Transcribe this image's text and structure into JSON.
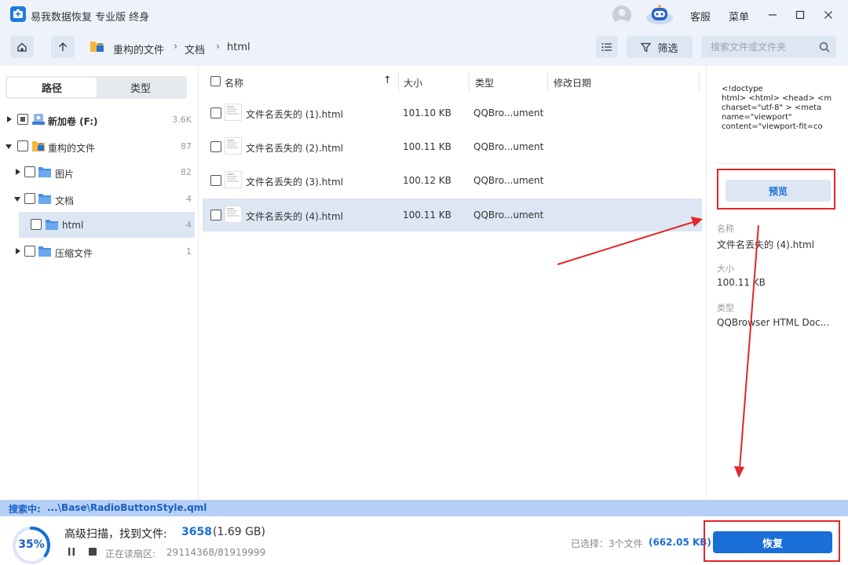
{
  "app": {
    "title": "易我数据恢复 专业版 终身",
    "service_label": "客服",
    "menu_label": "菜单"
  },
  "navbar": {
    "breadcrumb": [
      "重构的文件",
      "文档",
      "html"
    ],
    "filter_label": "筛选",
    "search_placeholder": "搜索文件或文件夹"
  },
  "left_panel": {
    "tabs": [
      {
        "label": "路径",
        "active": true
      },
      {
        "label": "类型",
        "active": false
      }
    ],
    "tree": [
      {
        "label": "新加卷 (F:)",
        "count": "3.6K",
        "icon": "drive-icon",
        "expanded": false,
        "selected": false
      },
      {
        "label": "重构的文件",
        "count": "87",
        "icon": "folder-lock-icon",
        "expanded": true,
        "selected": false
      },
      {
        "label": "图片",
        "count": "82",
        "icon": "folder-icon",
        "expanded": false,
        "selected": false
      },
      {
        "label": "文档",
        "count": "4",
        "icon": "folder-icon",
        "expanded": true,
        "selected": false
      },
      {
        "label": "html",
        "count": "4",
        "icon": "folder-icon",
        "expanded": false,
        "selected": true
      },
      {
        "label": "压缩文件",
        "count": "1",
        "icon": "folder-icon",
        "expanded": false,
        "selected": false
      }
    ]
  },
  "file_list": {
    "columns": [
      "名称",
      "大小",
      "类型",
      "修改日期"
    ],
    "rows": [
      {
        "name": "文件名丢失的 (1).html",
        "size": "101.10 KB",
        "type": "QQBro...ument",
        "date": "",
        "selected": false
      },
      {
        "name": "文件名丢失的 (2).html",
        "size": "100.11 KB",
        "type": "QQBro...ument",
        "date": "",
        "selected": false
      },
      {
        "name": "文件名丢失的 (3).html",
        "size": "100.12 KB",
        "type": "QQBro...ument",
        "date": "",
        "selected": false
      },
      {
        "name": "文件名丢失的 (4).html",
        "size": "100.11 KB",
        "type": "QQBro...ument",
        "date": "",
        "selected": true
      }
    ]
  },
  "right_panel": {
    "code_preview": "<!doctype\nhtml> <html> <head> <m\ncharset=\"utf-8\" > <meta\nname=\"viewport\"\ncontent=\"viewport-fit=co",
    "preview_label": "预览",
    "name_label": "名称",
    "name_value": "文件名丢失的 (4).html",
    "size_label": "大小",
    "size_value": "100.11 KB",
    "type_label": "类型",
    "type_value": "QQBrowser HTML Doc..."
  },
  "status": {
    "scan_label": "搜索中:",
    "scan_path": "...\\Base\\RadioButtonStyle.qml",
    "progress_text": "35%",
    "progress_value": 35,
    "scan_title": "高级扫描，找到文件:",
    "scan_count": "3658",
    "scan_size": "(1.69 GB)",
    "reading_label": "正在读扇区:",
    "reading_value": "29114368/81919999",
    "selected_summary": "已选择：3个文件",
    "selected_size": "(662.05 KB)",
    "recover_label": "恢复"
  },
  "colors": {
    "accent": "#1a6ed8",
    "annotation": "#e3262a",
    "chrome": "#eef3fb"
  }
}
